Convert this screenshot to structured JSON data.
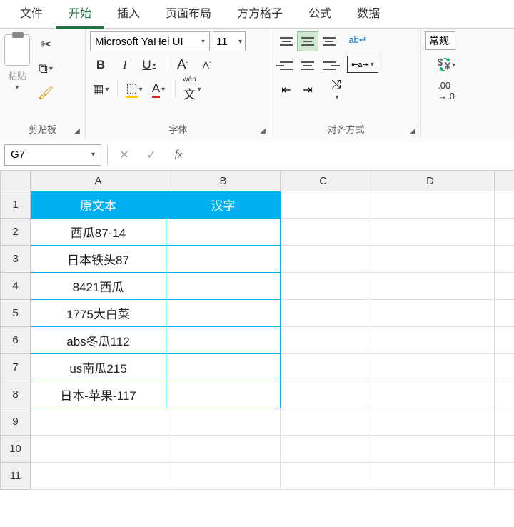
{
  "tabs": {
    "file": "文件",
    "home": "开始",
    "insert": "插入",
    "layout": "页面布局",
    "ffgz": "方方格子",
    "formula": "公式",
    "data": "数据"
  },
  "ribbon": {
    "clipboard": {
      "label": "剪贴板",
      "paste": "粘贴"
    },
    "font": {
      "label": "字体",
      "name": "Microsoft YaHei UI",
      "size": "11",
      "wen": "wén",
      "wenChar": "文"
    },
    "align": {
      "label": "对齐方式"
    },
    "number": {
      "label": "",
      "general": "常规"
    }
  },
  "nameBox": "G7",
  "columns": [
    "A",
    "B",
    "C",
    "D"
  ],
  "headers": {
    "a": "原文本",
    "b": "汉字"
  },
  "rows": [
    {
      "n": 1,
      "a": "",
      "b": "",
      "isHeader": true
    },
    {
      "n": 2,
      "a": "西瓜87-14",
      "b": ""
    },
    {
      "n": 3,
      "a": "日本铁头87",
      "b": ""
    },
    {
      "n": 4,
      "a": "8421西瓜",
      "b": ""
    },
    {
      "n": 5,
      "a": "1775大白菜",
      "b": ""
    },
    {
      "n": 6,
      "a": "abs冬瓜112",
      "b": ""
    },
    {
      "n": 7,
      "a": "us南瓜215",
      "b": ""
    },
    {
      "n": 8,
      "a": "日本-苹果-117",
      "b": ""
    },
    {
      "n": 9,
      "a": "",
      "b": ""
    },
    {
      "n": 10,
      "a": "",
      "b": ""
    },
    {
      "n": 11,
      "a": "",
      "b": ""
    }
  ]
}
